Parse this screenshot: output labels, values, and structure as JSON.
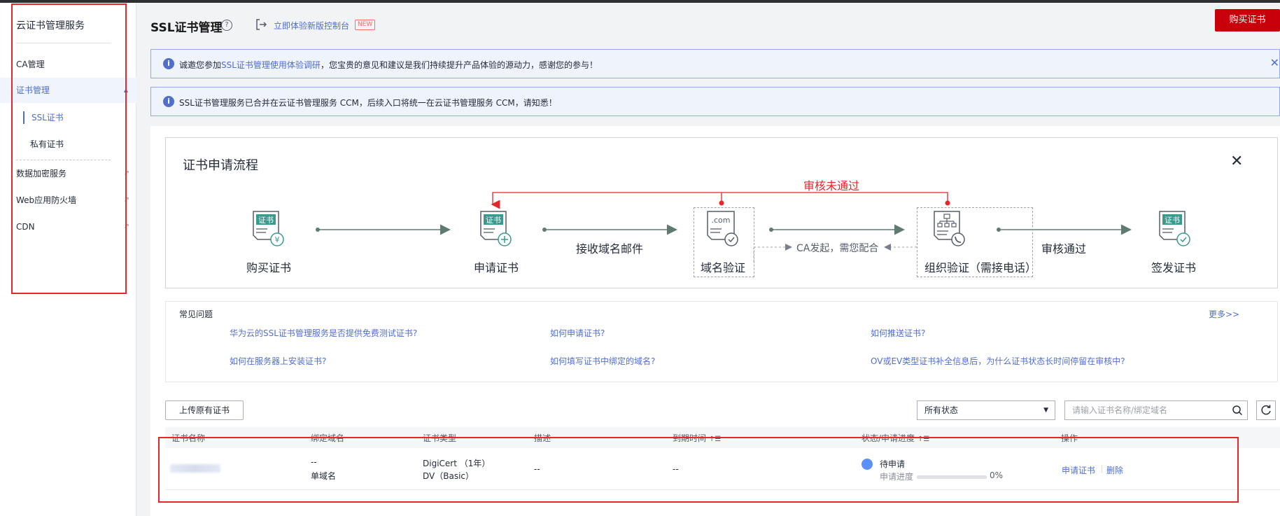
{
  "sidebar": {
    "title": "云证书管理服务",
    "items": [
      {
        "label": "CA管理"
      },
      {
        "label": "证书管理"
      },
      {
        "label": "SSL证书"
      },
      {
        "label": "私有证书"
      },
      {
        "label": "数据加密服务"
      },
      {
        "label": "Web应用防火墙"
      },
      {
        "label": "CDN"
      }
    ]
  },
  "header": {
    "title": "SSL证书管理",
    "new_console": "立即体验新版控制台",
    "new_badge": "NEW",
    "buy_button": "购买证书"
  },
  "alerts": {
    "survey_prefix": "诚邀您参加",
    "survey_link": "SSL证书管理使用体验调研",
    "survey_suffix": "，您宝贵的意见和建议是我们持续提升产品体验的源动力，感谢您的参与！",
    "merge_notice": "SSL证书管理服务已合并在云证书管理服务 CCM，后续入口将统一在云证书管理服务 CCM，请知悉！"
  },
  "flow": {
    "title": "证书申请流程",
    "steps": [
      "购买证书",
      "申请证书",
      "域名验证",
      "组织验证（需接电话）",
      "签发证书"
    ],
    "edge_receive_mail": "接收域名邮件",
    "edge_ca": "CA发起，需您配合",
    "edge_approved": "审核通过",
    "reject": "审核未通过",
    "icon_cert": "证书",
    "icon_com": ".com"
  },
  "faq": {
    "title": "常见问题",
    "more": "更多>>",
    "links": [
      "华为云的SSL证书管理服务是否提供免费测试证书?",
      "如何申请证书?",
      "如何推送证书?",
      "如何在服务器上安装证书?",
      "如何填写证书中绑定的域名?",
      "OV或EV类型证书补全信息后，为什么证书状态长时间停留在审核中?"
    ]
  },
  "toolbar": {
    "upload": "上传原有证书",
    "status_select": "所有状态",
    "search_placeholder": "请输入证书名称/绑定域名"
  },
  "table": {
    "headers": [
      "证书名称",
      "绑定域名",
      "证书类型",
      "描述",
      "到期时间",
      "状态/申请进度",
      "操作"
    ],
    "row": {
      "domain": "--",
      "domain_type": "单域名",
      "cert_type": "DigiCert  （1年）",
      "cert_level": "DV（Basic）",
      "description": "--",
      "expire": "--",
      "status": "待申请",
      "progress_label": "申请进度",
      "progress": "0%",
      "progress_value": 0,
      "action_apply": "申请证书",
      "action_delete": "删除"
    }
  }
}
